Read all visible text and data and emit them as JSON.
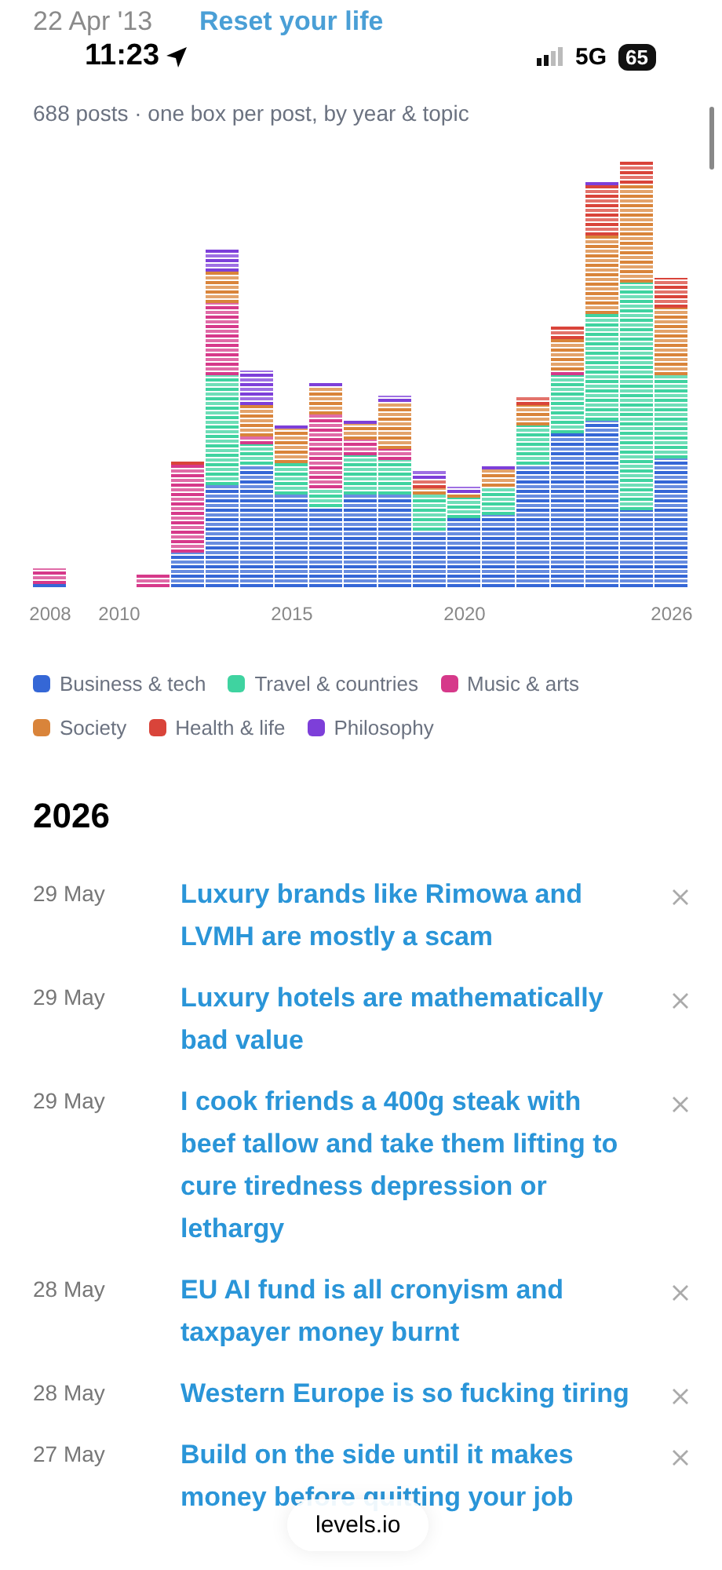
{
  "background_post": {
    "date": "22 Apr '13",
    "title": "Reset your life"
  },
  "status_bar": {
    "time": "11:23",
    "network": "5G",
    "battery": "65"
  },
  "summary": "688 posts · one box per post, by year & topic",
  "chart_axis_labels": [
    "2008",
    "2010",
    "2015",
    "2020",
    "2026"
  ],
  "legend": [
    {
      "label": "Business & tech",
      "color": "#3567d6"
    },
    {
      "label": "Travel & countries",
      "color": "#3fd3a0"
    },
    {
      "label": "Music & arts",
      "color": "#d6398a"
    },
    {
      "label": "Society",
      "color": "#d9843a"
    },
    {
      "label": "Health & life",
      "color": "#d9443a"
    },
    {
      "label": "Philosophy",
      "color": "#7d3fd9"
    }
  ],
  "year_heading": "2026",
  "posts": [
    {
      "date": "29 May",
      "title": "Luxury brands like Rimowa and LVMH are mostly a scam"
    },
    {
      "date": "29 May",
      "title": "Luxury hotels are mathematically bad value"
    },
    {
      "date": "29 May",
      "title": "I cook friends a 400g steak with beef tallow and take them lifting to cure tiredness depression or lethargy"
    },
    {
      "date": "28 May",
      "title": "EU AI fund is all cronyism and taxpayer money burnt"
    },
    {
      "date": "28 May",
      "title": "Western Europe is so fucking tiring"
    },
    {
      "date": "27 May",
      "title": "Build on the side until it makes money before quitting your job"
    }
  ],
  "site_badge": "levels.io"
}
